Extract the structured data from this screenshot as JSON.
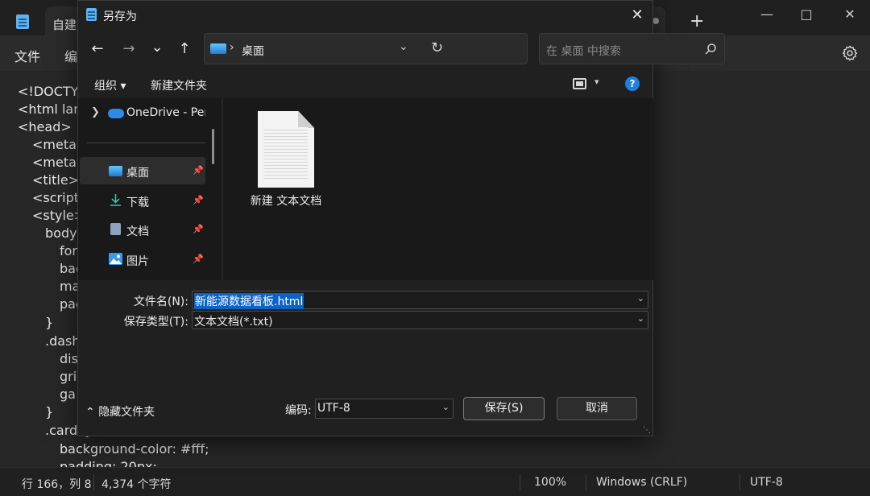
{
  "notepad": {
    "tab_title": "自建台",
    "menu": {
      "file": "文件",
      "edit": "编"
    },
    "code_lines": [
      "<!DOCTY",
      "<html lan",
      "<head>",
      "<meta",
      "<meta",
      "<title>",
      "<script",
      "<style>",
      "body",
      "for",
      "bac",
      "ma",
      "pac",
      "}",
      ".dash",
      "dis",
      "gri",
      "ga",
      "}",
      ".card {",
      "background-color: #fff;",
      "padding: 20px;"
    ],
    "status": {
      "position": "行 166，列 8",
      "chars": "4,374 个字符",
      "zoom": "100%",
      "line_ending": "Windows (CRLF)",
      "encoding": "UTF-8"
    }
  },
  "dialog": {
    "title": "另存为",
    "nav": {
      "back": "←",
      "forward": "→",
      "recent": "⌄",
      "up": "↑"
    },
    "address": {
      "separator": "›",
      "location": "桌面"
    },
    "search_placeholder": "在 桌面 中搜索",
    "commands": {
      "organize": "组织 ▾",
      "new_folder": "新建文件夹"
    },
    "sidebar": {
      "onedrive": "OneDrive - Pers",
      "items": [
        {
          "label": "桌面",
          "icon": "desktop-icon",
          "selected": true
        },
        {
          "label": "下载",
          "icon": "download-icon"
        },
        {
          "label": "文档",
          "icon": "document-icon"
        },
        {
          "label": "图片",
          "icon": "pictures-icon"
        }
      ]
    },
    "files": [
      {
        "name": "新建 文本文档",
        "icon": "text-file-icon"
      }
    ],
    "filename_label": "文件名(N):",
    "filename_value": "新能源数据看板.html",
    "filetype_label": "保存类型(T):",
    "filetype_value": "文本文档(*.txt)",
    "hide_folders": "隐藏文件夹",
    "encoding_label": "编码:",
    "encoding_value": "UTF-8",
    "save_button": "保存(S)",
    "cancel_button": "取消"
  },
  "colors": {
    "accent": "#1f7fe0",
    "selection": "#0a64c8"
  }
}
